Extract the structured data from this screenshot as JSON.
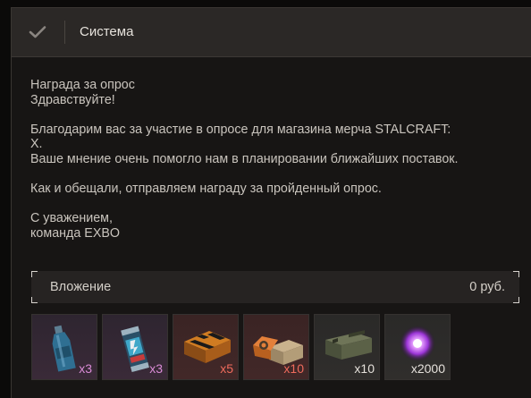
{
  "header": {
    "title": "Система"
  },
  "message": {
    "subject": "Награда за опрос",
    "greeting": "Здравствуйте!",
    "line1": "Благодарим вас за участие в опросе для магазина мерча STALCRAFT:",
    "line1_cont": "X.",
    "line2": "Ваше мнение очень помогло нам в планировании ближайших поставок.",
    "line3": "Как и обещали, отправляем награду за пройденный опрос.",
    "signoff": "С уважением,",
    "team": "команда EXBO"
  },
  "attachment": {
    "label": "Вложение",
    "price": "0 руб."
  },
  "items": [
    {
      "icon": "bottle-icon",
      "count": "x3",
      "rarity": "purple"
    },
    {
      "icon": "energy-can-icon",
      "count": "x3",
      "rarity": "purple"
    },
    {
      "icon": "crate-icon",
      "count": "x5",
      "rarity": "red"
    },
    {
      "icon": "box-icon",
      "count": "x10",
      "rarity": "red"
    },
    {
      "icon": "ammo-box-icon",
      "count": "x10",
      "rarity": "grey"
    },
    {
      "icon": "energy-orb-icon",
      "count": "x2000",
      "rarity": "grey"
    }
  ]
}
